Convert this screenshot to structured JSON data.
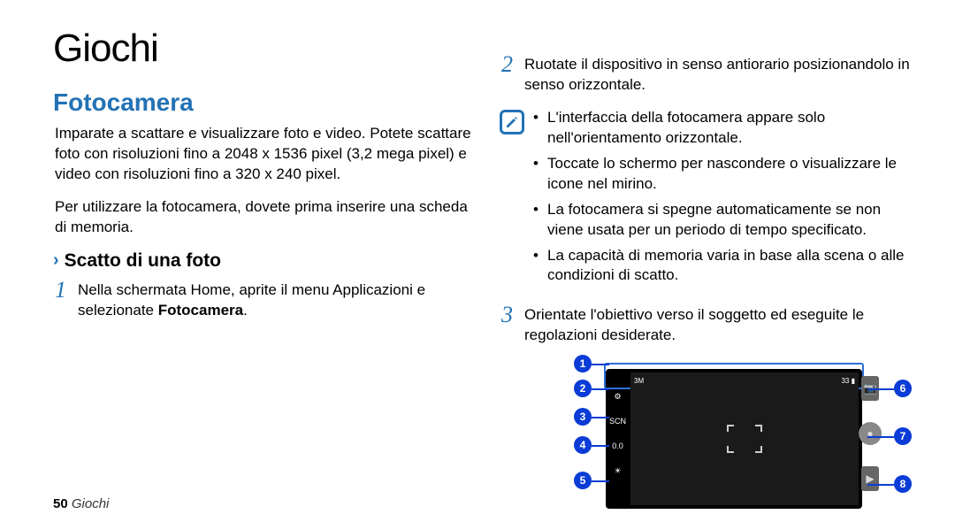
{
  "title": "Giochi",
  "left": {
    "heading": "Fotocamera",
    "intro1": "Imparate a scattare e visualizzare foto e video. Potete scattare foto con risoluzioni fino a 2048 x 1536 pixel (3,2 mega pixel) e video con risoluzioni fino a 320 x 240 pixel.",
    "intro2": "Per utilizzare la fotocamera, dovete prima inserire una scheda di memoria.",
    "subheading": "Scatto di una foto",
    "step1_pre": "Nella schermata Home, aprite il menu Applicazioni e selezionate ",
    "step1_bold": "Fotocamera",
    "step1_post": "."
  },
  "right": {
    "step2": "Ruotate il dispositivo in senso antiorario posizionandolo in senso orizzontale.",
    "notes": [
      "L'interfaccia della fotocamera appare solo nell'orientamento orizzontale.",
      "Toccate lo schermo per nascondere o visualizzare le icone nel mirino.",
      "La fotocamera si spegne automaticamente se non viene usata per un periodo di tempo specificato.",
      "La capacità di memoria varia in base alla scena o alle condizioni di scatto."
    ],
    "step3": "Orientate l'obiettivo verso il soggetto ed eseguite le regolazioni desiderate."
  },
  "camera": {
    "left_labels": [
      "SCN",
      "0.0"
    ],
    "status_left": "3M",
    "status_right": "33",
    "callouts": {
      "1": "1",
      "2": "2",
      "3": "3",
      "4": "4",
      "5": "5",
      "6": "6",
      "7": "7",
      "8": "8"
    }
  },
  "footer": {
    "page": "50",
    "label": "Giochi"
  }
}
